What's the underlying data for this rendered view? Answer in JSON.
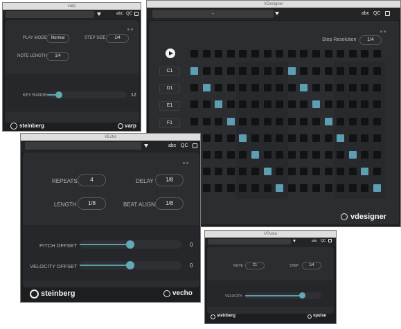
{
  "varp": {
    "title": "varp",
    "toolbar": {
      "preset": "",
      "abc": "abc",
      "qc": "QC"
    },
    "play_mode": {
      "label": "PLAY MODE",
      "value": "Normal"
    },
    "step_size": {
      "label": "STEP SIZE",
      "value": "1/4"
    },
    "note_length": {
      "label": "NOTE LENGTH",
      "value": "1/4"
    },
    "key_range": {
      "label": "KEY RANGE",
      "value": "12",
      "fraction": 0.07
    },
    "brand": "steinberg",
    "product": "varp"
  },
  "vdesigner": {
    "title": "VDesigner",
    "toolbar": {
      "preset": "-",
      "abc": "abc",
      "qc": "QC"
    },
    "step_resolution": {
      "label": "Step Resolution",
      "value": "1/4"
    },
    "notes": [
      "C1",
      "D1",
      "E1",
      "F1"
    ],
    "columns": 16,
    "rows": 8,
    "active_steps": [
      [
        0,
        0
      ],
      [
        1,
        1
      ],
      [
        2,
        2
      ],
      [
        3,
        3
      ],
      [
        4,
        4
      ],
      [
        5,
        5
      ],
      [
        6,
        6
      ],
      [
        7,
        7
      ],
      [
        8,
        0
      ],
      [
        9,
        1
      ],
      [
        10,
        2
      ],
      [
        11,
        3
      ],
      [
        12,
        4
      ],
      [
        13,
        5
      ],
      [
        14,
        6
      ],
      [
        15,
        7
      ]
    ],
    "product": "vdesigner",
    "accent": "#5c9fb3"
  },
  "vecho": {
    "title": "VEcho",
    "toolbar": {
      "preset": "",
      "abc": "abc",
      "qc": "QC"
    },
    "repeats": {
      "label": "REPEATS",
      "value": "4"
    },
    "delay": {
      "label": "DELAY",
      "value": "1/8"
    },
    "length": {
      "label": "LENGTH",
      "value": "1/8"
    },
    "beat_align": {
      "label": "BEAT ALIGN",
      "value": "1/8"
    },
    "pitch_offset": {
      "label": "PITCH OFFSET",
      "value": "0",
      "fraction": 0.5
    },
    "velocity_offset": {
      "label": "VELOCITY OFFSET",
      "value": "0",
      "fraction": 0.5
    },
    "brand": "steinberg",
    "product": "vecho"
  },
  "vpulse": {
    "title": "VPulse",
    "toolbar": {
      "preset": "",
      "abc": "abc",
      "qc": "QC"
    },
    "note": {
      "label": "NOTE",
      "value": "C1"
    },
    "step": {
      "label": "STEP",
      "value": "1/4"
    },
    "velocity": {
      "label": "VELOCITY",
      "fraction": 0.75
    },
    "brand": "steinberg",
    "product": "vpulse"
  }
}
